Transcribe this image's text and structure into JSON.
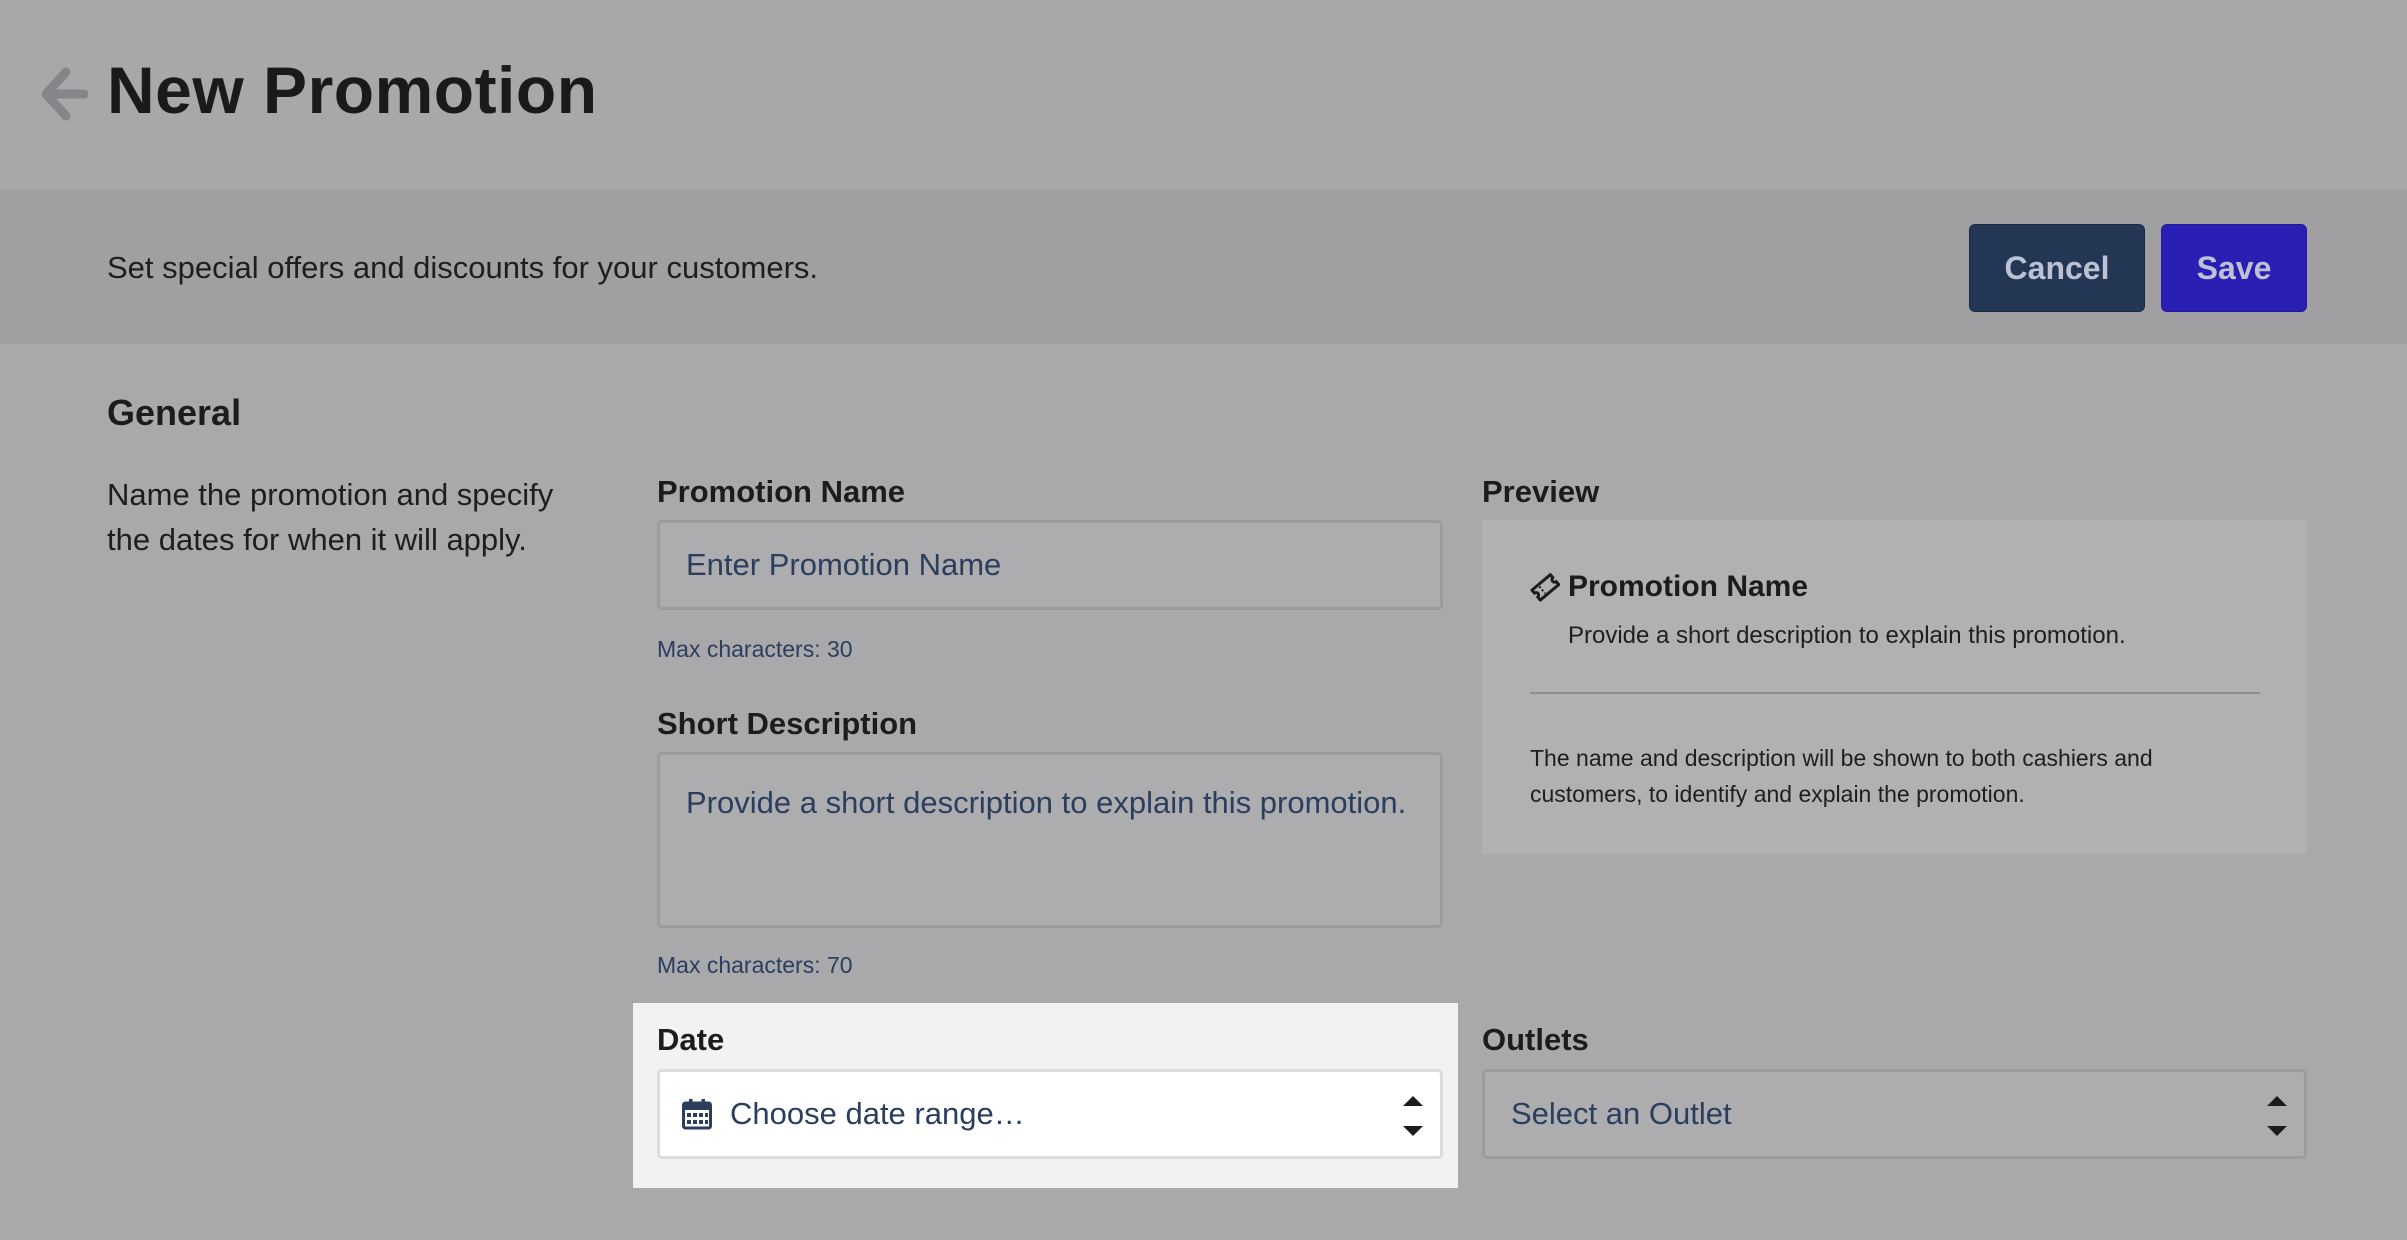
{
  "header": {
    "title": "New Promotion"
  },
  "subheader": {
    "description": "Set special offers and discounts for your customers.",
    "cancel_label": "Cancel",
    "save_label": "Save"
  },
  "general": {
    "title": "General",
    "description": "Name the promotion and specify the dates for when it will apply."
  },
  "form": {
    "promotion_name_label": "Promotion Name",
    "promotion_name_placeholder": "Enter Promotion Name",
    "promotion_name_hint": "Max characters: 30",
    "short_description_label": "Short Description",
    "short_description_placeholder": "Provide a short description to explain this promotion.",
    "short_description_hint": "Max characters: 70",
    "date_label": "Date",
    "date_placeholder": "Choose date range…",
    "outlets_label": "Outlets",
    "outlets_placeholder": "Select an Outlet"
  },
  "preview": {
    "label": "Preview",
    "name": "Promotion Name",
    "description": "Provide a short description to explain this promotion.",
    "note": "The name and description will be shown to both cashiers and customers, to identify and explain the promotion."
  },
  "icons": {
    "back": "arrow-left-icon",
    "ticket": "ticket-icon",
    "calendar": "calendar-icon",
    "stepper": "up-down-arrows-icon"
  },
  "colors": {
    "cancel_button": "#233754",
    "save_button": "#2a1fb5",
    "placeholder_text": "#2b3e5e"
  }
}
